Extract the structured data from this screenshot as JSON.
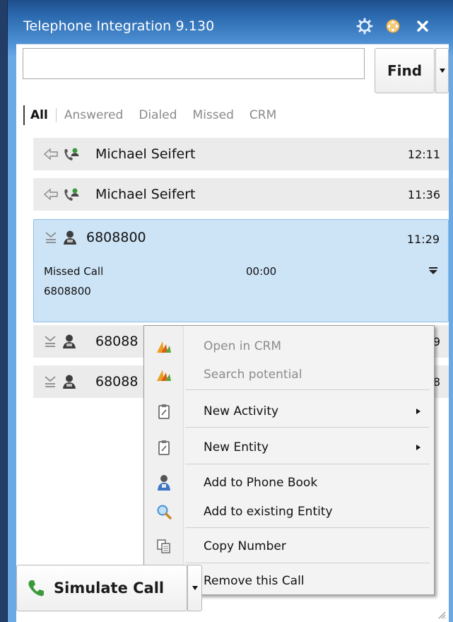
{
  "window": {
    "title": "Telephone Integration 9.130"
  },
  "search": {
    "value": "",
    "placeholder": "",
    "find_label": "Find"
  },
  "tabs": [
    {
      "label": "All",
      "active": true
    },
    {
      "label": "Answered",
      "active": false
    },
    {
      "label": "Dialed",
      "active": false
    },
    {
      "label": "Missed",
      "active": false
    },
    {
      "label": "CRM",
      "active": false
    }
  ],
  "calls": [
    {
      "name": "Michael Seifert",
      "time": "12:11",
      "direction_icon": "incoming-arrow-icon",
      "contact_icon": "contact-phone-icon"
    },
    {
      "name": "Michael Seifert",
      "time": "11:36",
      "direction_icon": "incoming-arrow-icon",
      "contact_icon": "contact-phone-icon"
    },
    {
      "name": "6808800",
      "time": "11:29",
      "direction_icon": "missed-call-icon",
      "contact_icon": "unknown-person-icon",
      "expanded": true,
      "status": "Missed Call",
      "duration": "00:00",
      "number": "6808800"
    },
    {
      "name": "68088",
      "time": "9",
      "direction_icon": "missed-call-icon",
      "contact_icon": "unknown-person-icon"
    },
    {
      "name": "68088",
      "time": "8",
      "direction_icon": "missed-call-icon",
      "contact_icon": "unknown-person-icon"
    }
  ],
  "context_menu": {
    "items": [
      {
        "label": "Open in CRM",
        "icon": "crm-logo-icon",
        "disabled": true
      },
      {
        "label": "Search potential",
        "icon": "crm-logo-icon",
        "disabled": true
      },
      {
        "label": "New Activity",
        "icon": "clipboard-icon",
        "submenu": true
      },
      {
        "label": "New Entity",
        "icon": "clipboard-icon",
        "submenu": true
      },
      {
        "label": "Add to Phone Book",
        "icon": "person-add-icon"
      },
      {
        "label": "Add to existing Entity",
        "icon": "magnifier-icon"
      },
      {
        "label": "Copy Number",
        "icon": "copy-icon"
      },
      {
        "label": "Remove this Call",
        "icon": "remove-circle-icon"
      }
    ]
  },
  "simulate": {
    "label": "Simulate Call"
  },
  "colors": {
    "title_gradient_top": "#1f4f8a",
    "title_gradient_bottom": "#6aa8e6",
    "selected_row": "#cde4f7",
    "row_bg": "#ebebeb",
    "phone_green": "#3a9a3a"
  }
}
